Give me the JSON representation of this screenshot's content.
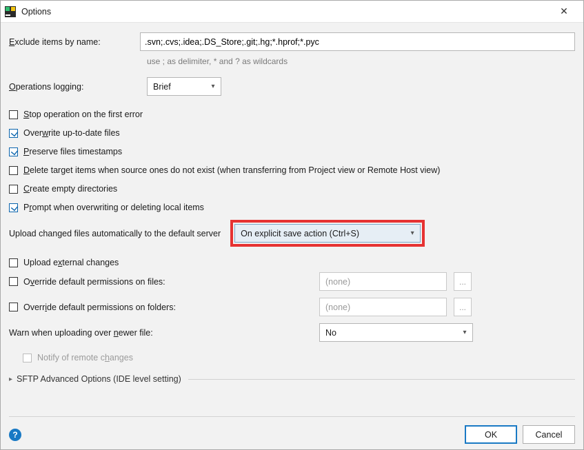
{
  "window": {
    "title": "Options",
    "close_glyph": "✕"
  },
  "exclude": {
    "label_pre": "E",
    "label_post": "xclude items by name:",
    "value": ".svn;.cvs;.idea;.DS_Store;.git;.hg;*.hprof;*.pyc",
    "hint": "use ; as delimiter, * and ? as wildcards"
  },
  "ops_logging": {
    "label_pre": "O",
    "label_post": "perations logging:",
    "value": "Brief"
  },
  "checks": {
    "stop_on_error": {
      "checked": false,
      "pre": "S",
      "mid": "top operation on the first error"
    },
    "overwrite_utd": {
      "checked": true,
      "pre": "Over",
      "u": "w",
      "post": "rite up-to-date files"
    },
    "preserve_ts": {
      "checked": true,
      "u": "P",
      "post": "reserve files timestamps"
    },
    "delete_targets": {
      "checked": false,
      "u": "D",
      "post": "elete target items when source ones do not exist (when transferring from Project view or Remote Host view)"
    },
    "create_empty": {
      "checked": false,
      "u": "C",
      "post": "reate empty directories"
    },
    "prompt_ow": {
      "checked": true,
      "pre": "P",
      "u": "r",
      "post": "ompt when overwriting or deleting local items"
    }
  },
  "upload_auto": {
    "label": "Upload changed files automatically to the default server",
    "value": "On explicit save action (Ctrl+S)"
  },
  "checks2": {
    "upload_external": {
      "checked": false,
      "pre": "Upload e",
      "u": "x",
      "post": "ternal changes"
    },
    "override_files": {
      "checked": false,
      "pre": "O",
      "u": "v",
      "post": "erride default permissions on files:"
    },
    "override_folders": {
      "checked": false,
      "pre": "Overr",
      "u": "i",
      "post": "de default permissions on folders:"
    }
  },
  "perm_placeholder": "(none)",
  "ellipsis": "...",
  "warn_newer": {
    "label_pre": "Warn when uploading over ",
    "u": "n",
    "label_post": "ewer file:",
    "value": "No"
  },
  "notify_remote": {
    "label_pre": "Notify of remote c",
    "u": "h",
    "label_post": "anges"
  },
  "expander": {
    "label": "SFTP Advanced Options (IDE level setting)"
  },
  "buttons": {
    "ok": "OK",
    "cancel": "Cancel"
  },
  "help_glyph": "?",
  "chevron_glyph": "▾",
  "triangle_glyph": "▸"
}
